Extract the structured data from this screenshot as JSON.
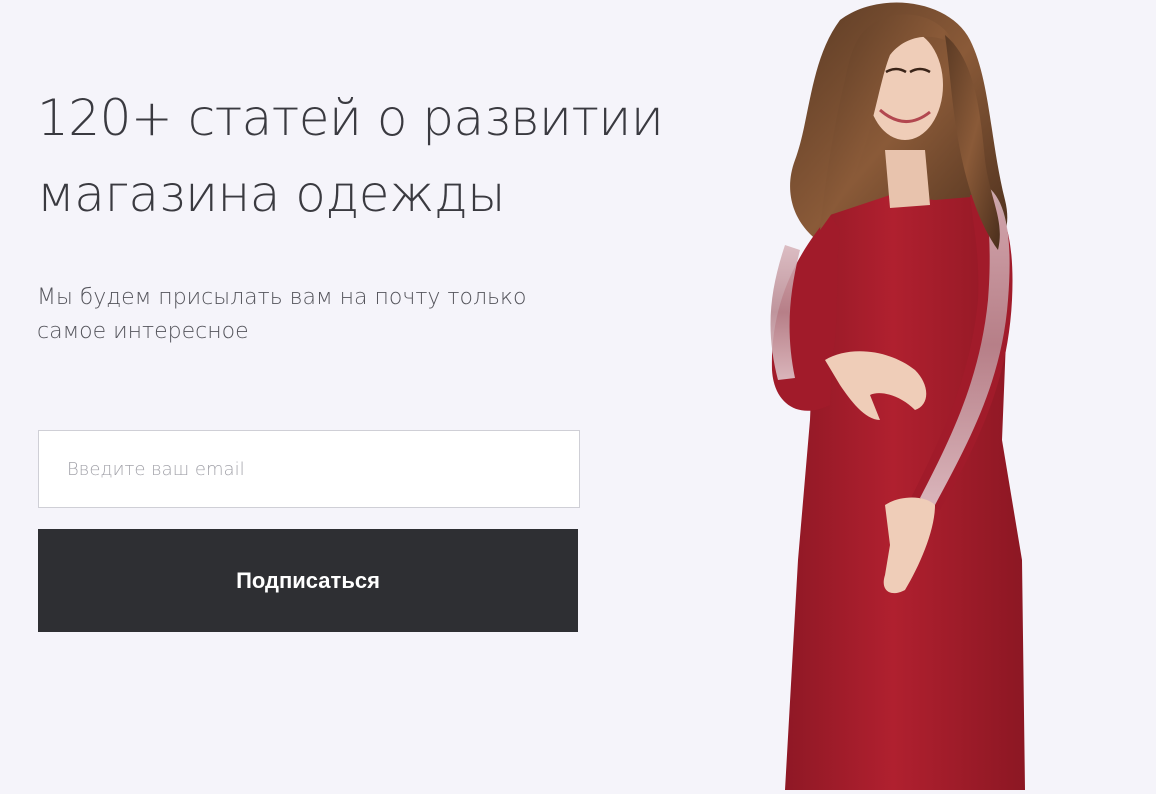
{
  "headline": {
    "line1": "120+ статей о развитии",
    "line2": "магазина одежды"
  },
  "subtext": {
    "line1": "Мы будем присылать вам на почту только",
    "line2": "самое интересное"
  },
  "form": {
    "email_placeholder": "Введите ваш email",
    "submit_label": "Подписаться"
  },
  "colors": {
    "background": "#f5f4fa",
    "button": "#2e2f33",
    "dress": "#a51d2c"
  }
}
